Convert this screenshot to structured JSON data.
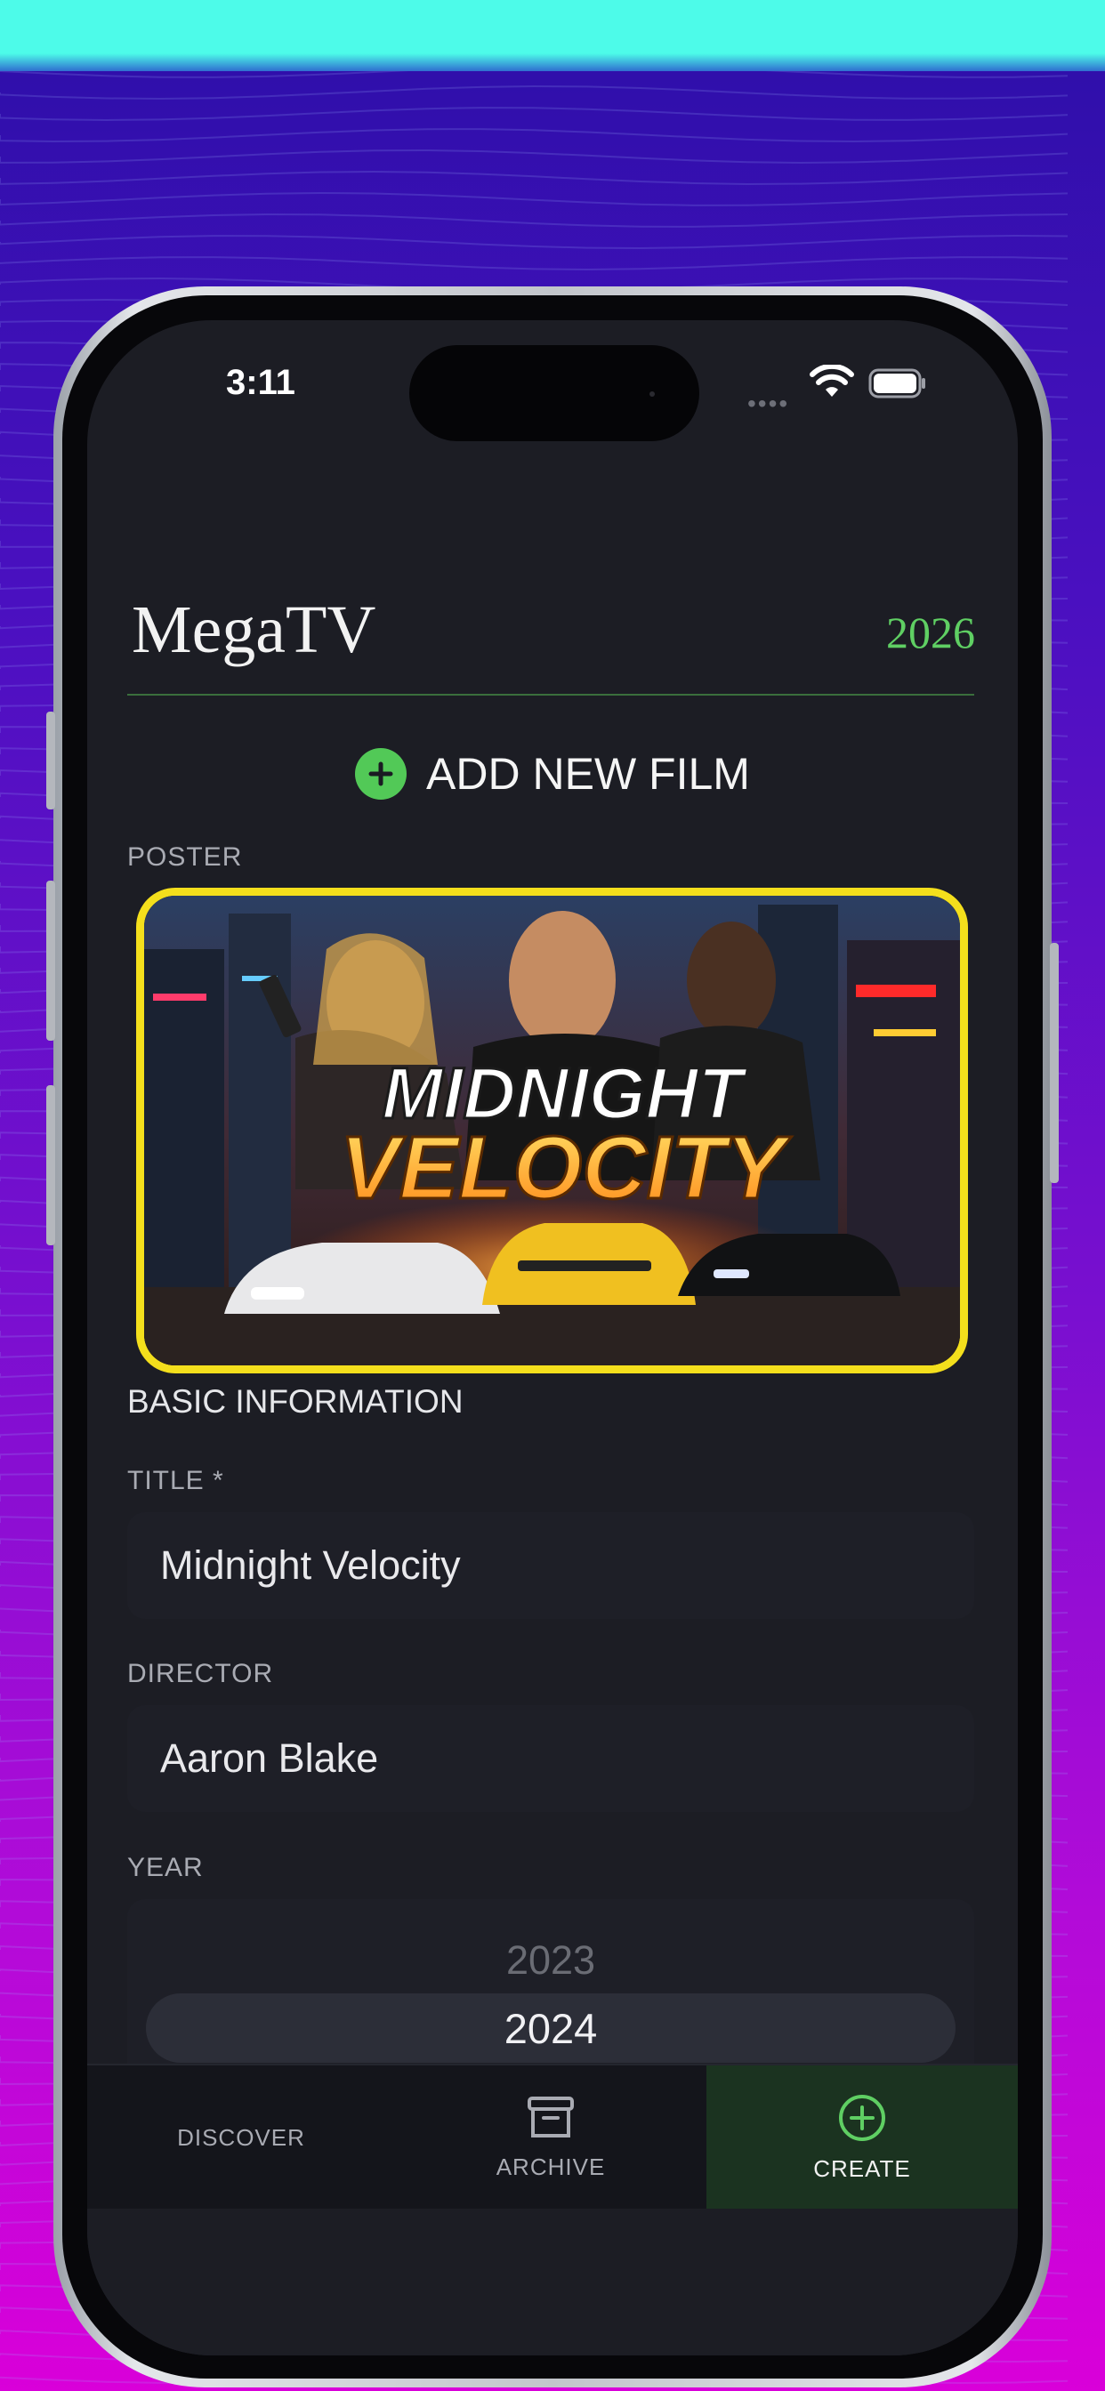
{
  "status_bar": {
    "time": "3:11",
    "signal_icon": "signal-dots-icon",
    "wifi_icon": "wifi-icon",
    "battery_icon": "battery-icon"
  },
  "app": {
    "name": "MegaTV",
    "year": "2026",
    "accent_color": "#5fcf63",
    "highlight_color": "#f4df1c"
  },
  "form": {
    "action_label": "ADD NEW FILM",
    "poster_label": "POSTER",
    "poster": {
      "title_line1": "MIDNIGHT",
      "title_line2": "VELOCITY"
    },
    "section_title": "BASIC INFORMATION",
    "title_label": "TITLE *",
    "title_value": "Midnight Velocity",
    "director_label": "DIRECTOR",
    "director_value": "Aaron Blake",
    "year_label": "YEAR",
    "year_options": [
      "2023",
      "2024"
    ],
    "year_selected": "2024"
  },
  "tabs": [
    {
      "label": "DISCOVER",
      "icon": "none",
      "active": false
    },
    {
      "label": "ARCHIVE",
      "icon": "archive-box-icon",
      "active": false
    },
    {
      "label": "CREATE",
      "icon": "plus-circle-icon",
      "active": true
    }
  ]
}
